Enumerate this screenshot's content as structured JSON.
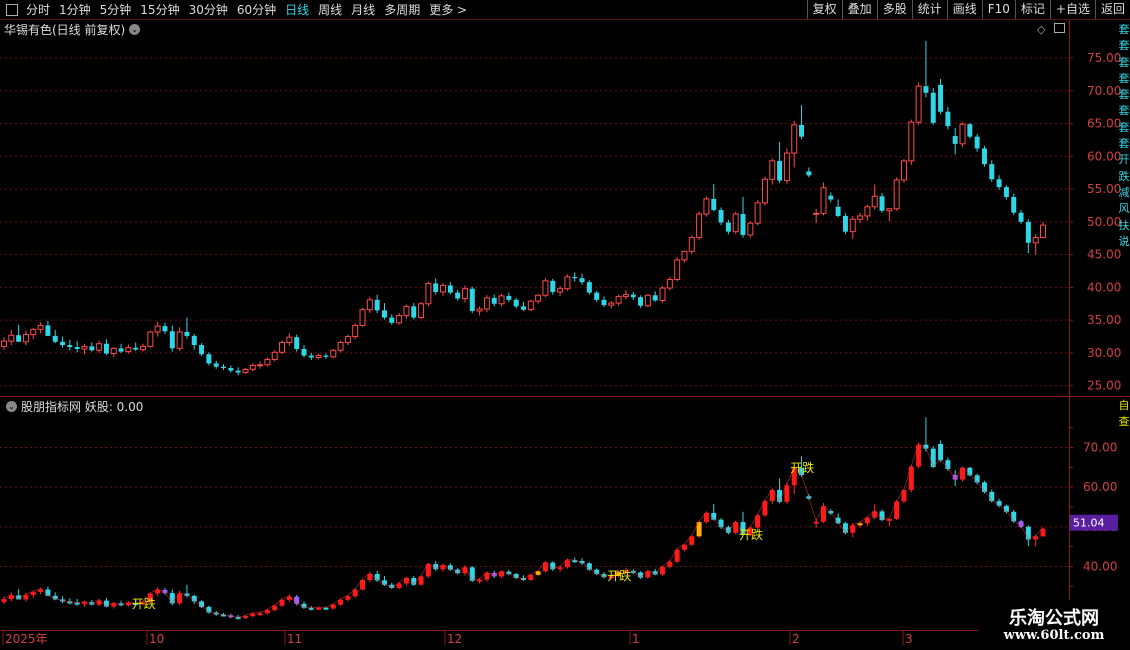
{
  "toolbar": {
    "tabs": [
      "分时",
      "1分钟",
      "5分钟",
      "15分钟",
      "30分钟",
      "60分钟",
      "日线",
      "周线",
      "月线",
      "多周期",
      "更多 >"
    ],
    "active_tab": "日线",
    "buttons": [
      "复权",
      "叠加",
      "多股",
      "统计",
      "画线",
      "F10",
      "标记",
      "+自选",
      "返回"
    ]
  },
  "main_panel": {
    "title": "华锡有色(日线 前复权)"
  },
  "indicator_panel": {
    "title": "股朋指标网 妖股: 0.00",
    "crosshair_value": "51.04"
  },
  "main_axis_labels": [
    "75.00",
    "70.00",
    "65.00",
    "60.00",
    "55.00",
    "50.00",
    "45.00",
    "40.00",
    "35.00",
    "30.00",
    "25.00"
  ],
  "indicator_axis_labels": [
    "70.00",
    "60.00",
    "50.00",
    "40.00"
  ],
  "x_axis_labels": [
    "2025年",
    "10",
    "11",
    "12",
    "1",
    "2",
    "3"
  ],
  "signals": [
    {
      "label": "开跌",
      "index": 18
    },
    {
      "label": "开跌",
      "index": 83
    },
    {
      "label": "开跌",
      "index": 101
    },
    {
      "label": "开跌",
      "index": 108
    }
  ],
  "right_strip": {
    "top": "套套套套套套套套开跌减风扶说",
    "bottom": "自查"
  },
  "watermark": {
    "name": "乐淘公式网",
    "url": "www.60lt.com"
  },
  "colors": {
    "up": "#ff4a4a",
    "down": "#2fd7e6",
    "grid": "#6a1010",
    "border": "#8b1a1a",
    "text": "#ddd",
    "active": "#2fd7e6"
  },
  "chart_data": {
    "type": "candlestick",
    "y_range_main": [
      22.5,
      77.5
    ],
    "y_range_indicator": [
      33,
      78
    ],
    "ohlc": [
      [
        31.0,
        32.4,
        30.5,
        31.8
      ],
      [
        31.8,
        33.5,
        31.2,
        32.7
      ],
      [
        32.7,
        34.3,
        31.8,
        31.7
      ],
      [
        31.7,
        33.4,
        31.2,
        32.8
      ],
      [
        32.8,
        33.8,
        32.1,
        33.6
      ],
      [
        33.6,
        34.7,
        33.0,
        34.2
      ],
      [
        34.2,
        34.9,
        32.6,
        32.6
      ],
      [
        32.6,
        33.5,
        31.5,
        31.7
      ],
      [
        31.7,
        32.5,
        30.8,
        31.2
      ],
      [
        31.2,
        32.0,
        30.4,
        30.9
      ],
      [
        30.9,
        31.8,
        30.1,
        30.6
      ],
      [
        30.6,
        31.4,
        29.8,
        31.0
      ],
      [
        31.0,
        31.6,
        30.2,
        30.4
      ],
      [
        30.4,
        31.9,
        30.0,
        31.4
      ],
      [
        31.4,
        32.1,
        29.7,
        29.9
      ],
      [
        29.9,
        30.9,
        29.4,
        30.7
      ],
      [
        30.7,
        31.4,
        30.0,
        30.2
      ],
      [
        30.2,
        31.3,
        29.9,
        30.8
      ],
      [
        30.8,
        31.6,
        30.3,
        30.5
      ],
      [
        30.5,
        31.4,
        30.2,
        31.0
      ],
      [
        31.0,
        33.4,
        30.8,
        33.2
      ],
      [
        33.2,
        34.8,
        32.5,
        34.1
      ],
      [
        34.1,
        34.6,
        32.9,
        33.3
      ],
      [
        33.3,
        34.2,
        30.2,
        30.7
      ],
      [
        30.7,
        33.9,
        30.3,
        33.2
      ],
      [
        33.2,
        35.4,
        32.2,
        32.6
      ],
      [
        32.6,
        32.9,
        30.5,
        31.2
      ],
      [
        31.2,
        31.5,
        29.5,
        29.8
      ],
      [
        29.8,
        30.1,
        28.1,
        28.4
      ],
      [
        28.4,
        28.8,
        27.6,
        27.9
      ],
      [
        27.9,
        28.3,
        27.4,
        27.7
      ],
      [
        27.7,
        28.1,
        27.0,
        27.3
      ],
      [
        27.3,
        27.8,
        26.6,
        27.0
      ],
      [
        27.0,
        27.7,
        26.8,
        27.5
      ],
      [
        27.5,
        28.4,
        27.2,
        28.1
      ],
      [
        28.1,
        28.7,
        27.6,
        28.2
      ],
      [
        28.2,
        29.3,
        27.9,
        29.0
      ],
      [
        29.0,
        30.4,
        28.7,
        30.1
      ],
      [
        30.1,
        31.9,
        29.8,
        31.6
      ],
      [
        31.6,
        33.0,
        31.1,
        32.4
      ],
      [
        32.4,
        32.8,
        30.2,
        30.6
      ],
      [
        30.6,
        31.2,
        29.3,
        29.6
      ],
      [
        29.6,
        30.0,
        28.9,
        29.3
      ],
      [
        29.3,
        29.9,
        29.0,
        29.6
      ],
      [
        29.6,
        29.9,
        29.1,
        29.4
      ],
      [
        29.4,
        30.6,
        29.2,
        30.4
      ],
      [
        30.4,
        31.9,
        30.1,
        31.6
      ],
      [
        31.6,
        32.8,
        31.2,
        32.5
      ],
      [
        32.5,
        34.5,
        32.1,
        34.2
      ],
      [
        34.2,
        36.9,
        34.0,
        36.6
      ],
      [
        36.6,
        38.6,
        36.1,
        38.1
      ],
      [
        38.1,
        38.9,
        36.1,
        36.5
      ],
      [
        36.5,
        37.6,
        35.1,
        35.4
      ],
      [
        35.4,
        35.9,
        34.3,
        34.6
      ],
      [
        34.6,
        36.1,
        34.3,
        35.7
      ],
      [
        35.7,
        37.4,
        35.2,
        37.1
      ],
      [
        37.1,
        37.6,
        35.1,
        35.4
      ],
      [
        35.4,
        37.8,
        35.2,
        37.5
      ],
      [
        37.5,
        40.9,
        37.1,
        40.6
      ],
      [
        40.6,
        41.4,
        38.9,
        39.3
      ],
      [
        39.3,
        40.7,
        38.7,
        40.3
      ],
      [
        40.3,
        40.8,
        38.9,
        39.2
      ],
      [
        39.2,
        39.6,
        38.0,
        38.3
      ],
      [
        38.3,
        40.3,
        37.7,
        39.8
      ],
      [
        39.8,
        40.1,
        36.1,
        36.4
      ],
      [
        36.4,
        37.1,
        35.7,
        36.7
      ],
      [
        36.7,
        38.8,
        36.2,
        38.4
      ],
      [
        38.4,
        38.9,
        37.1,
        37.5
      ],
      [
        37.5,
        39.0,
        37.1,
        38.7
      ],
      [
        38.7,
        39.2,
        37.8,
        38.1
      ],
      [
        38.1,
        38.4,
        36.8,
        37.1
      ],
      [
        37.1,
        37.8,
        36.4,
        36.6
      ],
      [
        36.6,
        38.1,
        36.4,
        37.9
      ],
      [
        37.9,
        39.0,
        37.5,
        38.8
      ],
      [
        38.8,
        41.4,
        38.5,
        41.0
      ],
      [
        41.0,
        41.3,
        38.9,
        39.3
      ],
      [
        39.3,
        40.2,
        38.7,
        39.8
      ],
      [
        39.8,
        42.0,
        39.5,
        41.6
      ],
      [
        41.6,
        42.3,
        40.9,
        41.4
      ],
      [
        41.4,
        42.1,
        40.4,
        40.8
      ],
      [
        40.8,
        41.1,
        38.9,
        39.2
      ],
      [
        39.2,
        39.5,
        37.8,
        38.1
      ],
      [
        38.1,
        38.6,
        37.0,
        37.3
      ],
      [
        37.3,
        37.9,
        36.8,
        37.6
      ],
      [
        37.6,
        38.9,
        37.2,
        38.6
      ],
      [
        38.6,
        39.6,
        38.2,
        38.9
      ],
      [
        38.9,
        39.3,
        38.1,
        38.5
      ],
      [
        38.5,
        38.8,
        36.9,
        37.2
      ],
      [
        37.2,
        39.0,
        37.0,
        38.8
      ],
      [
        38.8,
        39.4,
        37.8,
        38.0
      ],
      [
        38.0,
        40.2,
        37.7,
        39.9
      ],
      [
        39.9,
        41.6,
        39.5,
        41.2
      ],
      [
        41.2,
        44.6,
        40.9,
        44.2
      ],
      [
        44.2,
        45.6,
        43.8,
        45.5
      ],
      [
        45.5,
        47.9,
        45.1,
        47.6
      ],
      [
        47.6,
        51.6,
        47.2,
        51.2
      ],
      [
        51.2,
        53.9,
        50.8,
        53.5
      ],
      [
        53.5,
        55.8,
        51.6,
        51.8
      ],
      [
        51.8,
        52.2,
        49.5,
        49.9
      ],
      [
        49.9,
        50.3,
        48.1,
        48.5
      ],
      [
        48.5,
        51.5,
        48.2,
        51.2
      ],
      [
        51.2,
        53.8,
        47.6,
        48.0
      ],
      [
        48.0,
        50.1,
        47.6,
        49.8
      ],
      [
        49.8,
        53.3,
        49.5,
        52.9
      ],
      [
        52.9,
        56.9,
        52.5,
        56.5
      ],
      [
        56.5,
        59.7,
        55.7,
        59.3
      ],
      [
        59.3,
        62.2,
        55.9,
        56.3
      ],
      [
        56.3,
        61.2,
        55.8,
        60.5
      ],
      [
        60.5,
        65.4,
        58.3,
        64.8
      ],
      [
        64.8,
        67.8,
        62.6,
        63.0
      ],
      [
        57.7,
        58.3,
        56.8,
        57.1
      ],
      [
        51.3,
        52.0,
        49.8,
        51.3
      ],
      [
        51.3,
        56.0,
        51.0,
        55.2
      ],
      [
        54.0,
        54.5,
        53.0,
        53.4
      ],
      [
        52.3,
        53.4,
        50.7,
        50.9
      ],
      [
        50.9,
        51.3,
        48.1,
        48.5
      ],
      [
        48.5,
        50.9,
        47.4,
        50.4
      ],
      [
        50.4,
        51.4,
        49.8,
        50.9
      ],
      [
        50.9,
        52.6,
        50.2,
        52.3
      ],
      [
        52.3,
        55.7,
        51.9,
        53.9
      ],
      [
        53.9,
        54.4,
        51.4,
        51.7
      ],
      [
        51.7,
        52.1,
        50.1,
        52.0
      ],
      [
        52.0,
        56.8,
        51.7,
        56.4
      ],
      [
        56.4,
        59.6,
        56.0,
        59.3
      ],
      [
        59.3,
        65.6,
        58.7,
        65.2
      ],
      [
        65.2,
        71.3,
        64.8,
        70.7
      ],
      [
        70.7,
        77.6,
        69.0,
        69.7
      ],
      [
        69.7,
        70.4,
        64.8,
        65.1
      ],
      [
        70.9,
        71.8,
        66.4,
        66.8
      ],
      [
        66.8,
        67.5,
        64.1,
        64.6
      ],
      [
        63.1,
        64.3,
        60.3,
        61.9
      ],
      [
        61.9,
        65.2,
        61.4,
        64.9
      ],
      [
        64.9,
        65.1,
        62.7,
        63.0
      ],
      [
        63.0,
        63.4,
        60.7,
        61.2
      ],
      [
        61.2,
        61.6,
        58.4,
        58.8
      ],
      [
        58.8,
        59.4,
        56.1,
        56.5
      ],
      [
        56.5,
        57.1,
        54.9,
        55.3
      ],
      [
        55.3,
        55.6,
        53.4,
        53.8
      ],
      [
        53.8,
        54.3,
        51.0,
        51.4
      ],
      [
        51.4,
        51.8,
        49.7,
        50.0
      ],
      [
        50.0,
        50.4,
        45.2,
        46.8
      ],
      [
        46.8,
        48.1,
        45.0,
        47.6
      ],
      [
        47.6,
        50.0,
        47.5,
        49.5
      ]
    ]
  }
}
